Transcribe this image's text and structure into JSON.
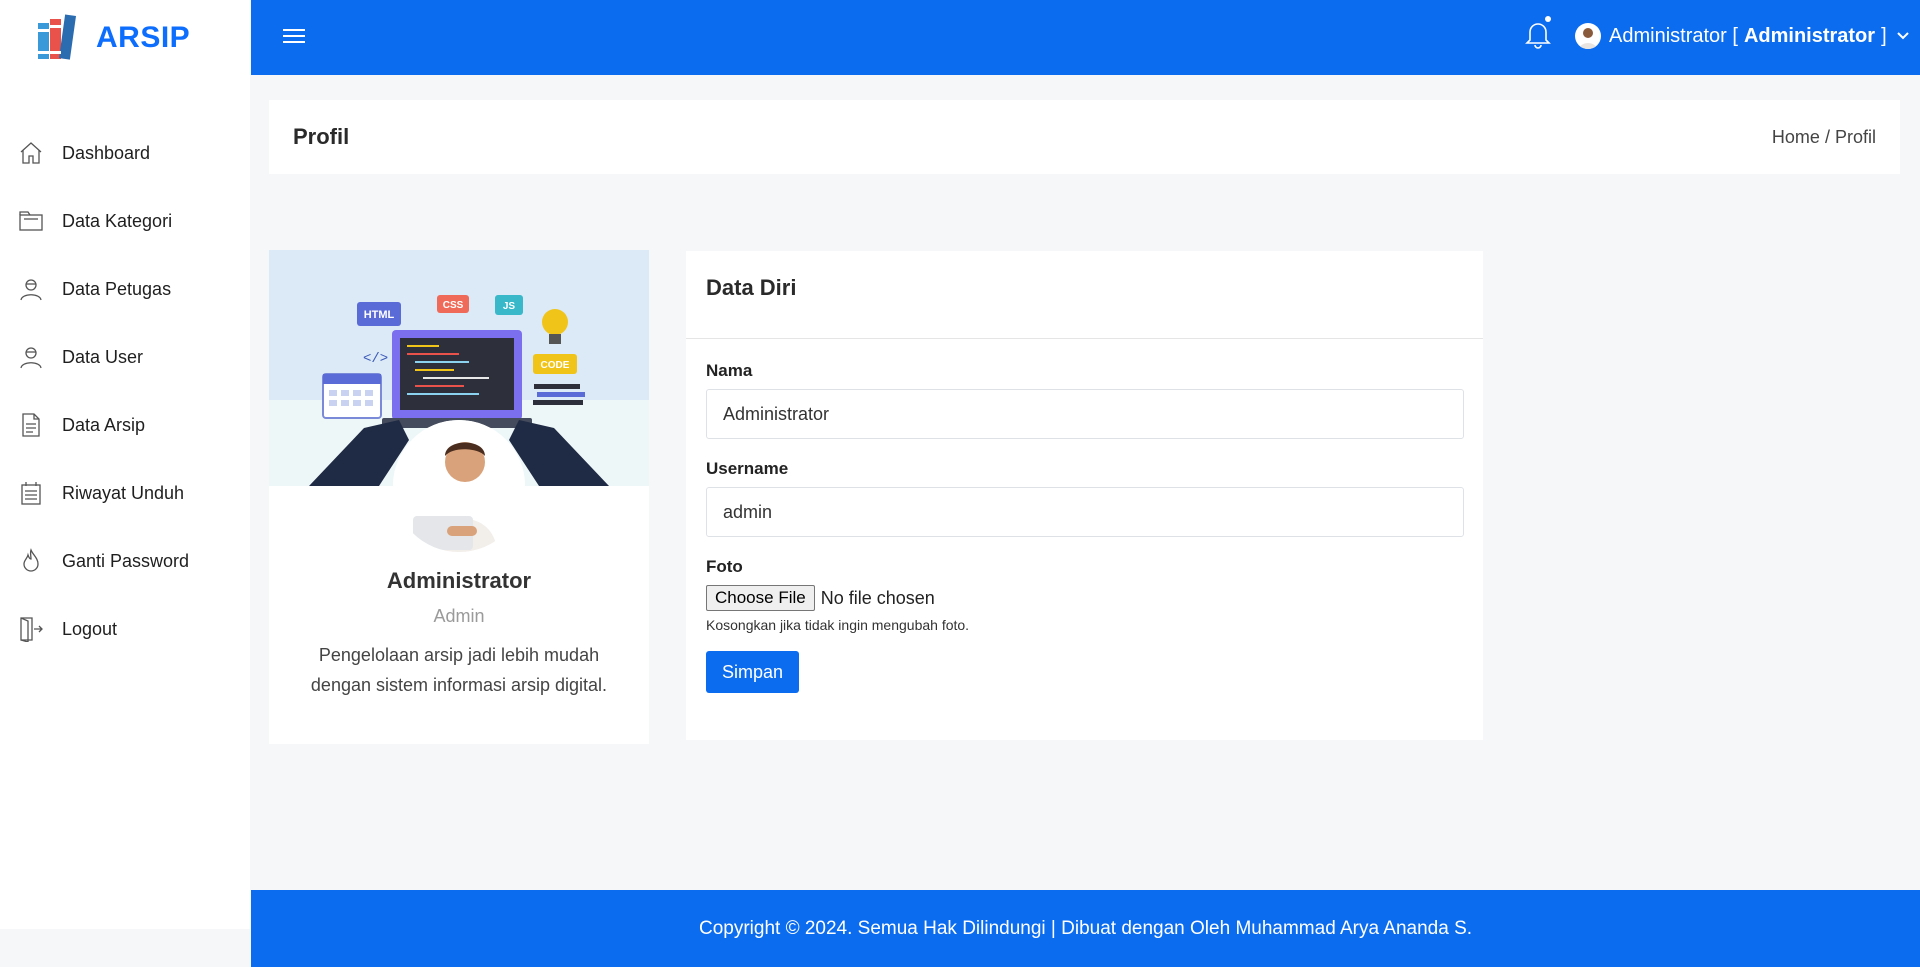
{
  "app": {
    "name": "ARSIP"
  },
  "sidebar": {
    "items": [
      {
        "label": "Dashboard",
        "icon": "home-icon"
      },
      {
        "label": "Data Kategori",
        "icon": "folder-icon"
      },
      {
        "label": "Data Petugas",
        "icon": "user-icon"
      },
      {
        "label": "Data User",
        "icon": "user-icon"
      },
      {
        "label": "Data Arsip",
        "icon": "document-icon"
      },
      {
        "label": "Riwayat Unduh",
        "icon": "history-icon"
      },
      {
        "label": "Ganti Password",
        "icon": "flame-icon"
      },
      {
        "label": "Logout",
        "icon": "logout-icon"
      }
    ]
  },
  "topbar": {
    "user_name": "Administrator [",
    "user_role": "Administrator",
    "user_suffix": "]"
  },
  "page": {
    "title": "Profil",
    "breadcrumb_home": "Home",
    "breadcrumb_sep": "/",
    "breadcrumb_current": "Profil"
  },
  "profile": {
    "name": "Administrator",
    "role": "Admin",
    "description": "Pengelolaan arsip jadi lebih mudah dengan sistem informasi arsip digital.",
    "hero_tags": {
      "html": "HTML",
      "css": "CSS",
      "js": "JS",
      "code": "CODE"
    }
  },
  "form": {
    "title": "Data Diri",
    "name_label": "Nama",
    "name_value": "Administrator",
    "username_label": "Username",
    "username_value": "admin",
    "photo_label": "Foto",
    "file_button": "Choose File",
    "file_status": "No file chosen",
    "photo_help": "Kosongkan jika tidak ingin mengubah foto.",
    "save_button": "Simpan"
  },
  "footer": {
    "text": "Copyright © 2024. Semua Hak Dilindungi | Dibuat dengan Oleh Muhammad Arya Ananda S."
  },
  "colors": {
    "primary": "#0b6cf0",
    "background": "#f5f7f9"
  }
}
